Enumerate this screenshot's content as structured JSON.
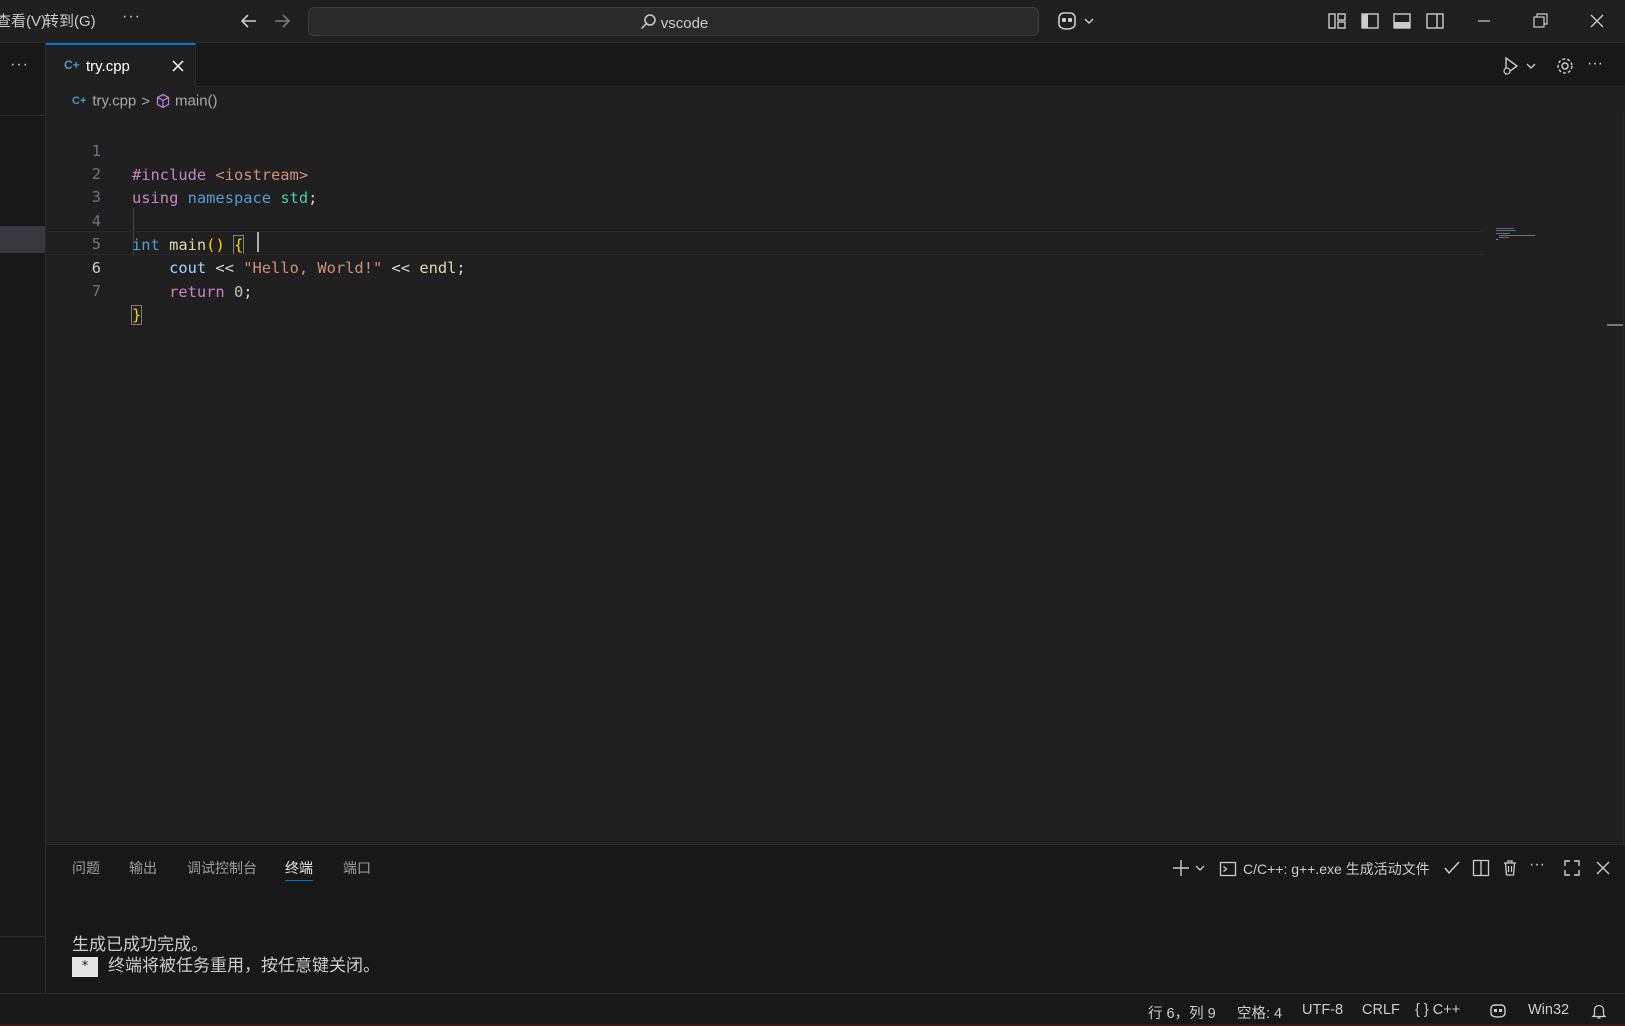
{
  "titlebar": {
    "menu": [
      "查看(V)",
      "转到(G)"
    ],
    "more": "···",
    "search_text": "vscode"
  },
  "leftstrip": {
    "more": "···"
  },
  "tabs": [
    {
      "icon": "C+",
      "label": "try.cpp",
      "active": true
    }
  ],
  "breadcrumb": {
    "file_icon": "C+",
    "file": "try.cpp",
    "separator": ">",
    "symbol": "main()"
  },
  "editor": {
    "current_line": 6,
    "lines": [
      {
        "n": "1"
      },
      {
        "n": "2"
      },
      {
        "n": "3"
      },
      {
        "n": "4"
      },
      {
        "n": "5"
      },
      {
        "n": "6"
      },
      {
        "n": "7"
      }
    ],
    "tokens": {
      "l1_pp": "#include",
      "l1_sp": " ",
      "l1_inc": "<iostream>",
      "l2_kw1": "using",
      "l2_sp1": " ",
      "l2_kw2": "namespace",
      "l2_sp2": " ",
      "l2_ns": "std",
      "l2_semi": ";",
      "l4_kw": "int",
      "l4_sp": " ",
      "l4_fn": "main",
      "l4_paren": "()",
      "l4_sp2": " ",
      "l4_brace": "{",
      "l5_indent": "    ",
      "l5_var": "cout",
      "l5_op1": " << ",
      "l5_str": "\"Hello, World!\"",
      "l5_op2": " << ",
      "l5_fn": "endl",
      "l5_semi": ";",
      "l6_indent": "    ",
      "l6_kw": "return",
      "l6_sp": " ",
      "l6_num": "0",
      "l6_semi": ";",
      "l7_brace": "}"
    }
  },
  "panel": {
    "tabs": [
      "问题",
      "输出",
      "调试控制台",
      "终端",
      "端口"
    ],
    "active_tab": "终端",
    "terminal_name": "C/C++: g++.exe 生成活动文件",
    "output": [
      {
        "text": "生成已成功完成。"
      },
      {
        "badge": "*",
        "text": "终端将被任务重用，按任意键关闭。"
      }
    ]
  },
  "statusbar": {
    "position": "行 6，列 9",
    "spaces": "空格: 4",
    "encoding": "UTF-8",
    "eol": "CRLF",
    "language": "C++",
    "language_icon": "{ }",
    "platform": "Win32"
  },
  "colors": {
    "accent": "#0078d4",
    "editor_bg": "#1f1f1f",
    "chrome_bg": "#181818"
  }
}
